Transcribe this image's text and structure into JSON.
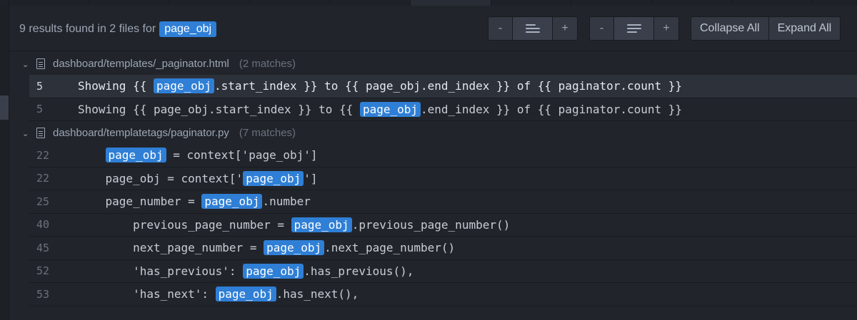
{
  "summary": {
    "text": "9 results found in 2 files for",
    "query": "page_obj"
  },
  "controls": {
    "minus": "-",
    "plus": "+",
    "collapse_all": "Collapse All",
    "expand_all": "Expand All"
  },
  "files": [
    {
      "name": "dashboard/templates/_paginator.html",
      "count": "(2 matches)",
      "matches": [
        {
          "line": "5",
          "before": "Showing {{ ",
          "match": "page_obj",
          "after": ".start_index }} to {{ page_obj.end_index }} of {{ paginator.count }}"
        },
        {
          "line": "5",
          "before": "Showing {{ page_obj.start_index }} to {{ ",
          "match": "page_obj",
          "after": ".end_index }} of {{ paginator.count }}"
        }
      ]
    },
    {
      "name": "dashboard/templatetags/paginator.py",
      "count": "(7 matches)",
      "matches": [
        {
          "line": "22",
          "before": "    ",
          "match": "page_obj",
          "after": " = context['page_obj']"
        },
        {
          "line": "22",
          "before": "    page_obj = context['",
          "match": "page_obj",
          "after": "']"
        },
        {
          "line": "25",
          "before": "    page_number = ",
          "match": "page_obj",
          "after": ".number"
        },
        {
          "line": "40",
          "before": "        previous_page_number = ",
          "match": "page_obj",
          "after": ".previous_page_number()"
        },
        {
          "line": "45",
          "before": "        next_page_number = ",
          "match": "page_obj",
          "after": ".next_page_number()"
        },
        {
          "line": "52",
          "before": "        'has_previous': ",
          "match": "page_obj",
          "after": ".has_previous(),"
        },
        {
          "line": "53",
          "before": "        'has_next': ",
          "match": "page_obj",
          "after": ".has_next(),"
        }
      ]
    }
  ],
  "colors": {
    "highlight": "#2f7fd6",
    "background": "#21252b",
    "selected_row": "#2c313a"
  }
}
